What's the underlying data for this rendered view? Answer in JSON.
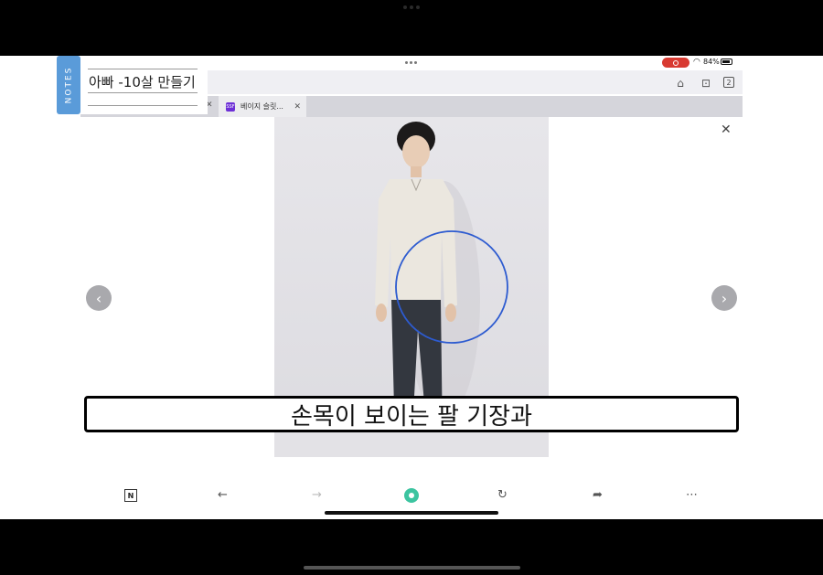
{
  "status": {
    "battery": "84%"
  },
  "notes": {
    "tab_label": "NOTES",
    "title": "아빠 -10살 만들기"
  },
  "browser": {
    "tab_count": "2"
  },
  "tabs": [
    {
      "label": "베이지 슬릿...",
      "favicon": "SSF",
      "active": true
    }
  ],
  "subtitle": "손목이 보이는 팔 기장과",
  "colors": {
    "accent_green": "#3cc4a0",
    "record_red": "#d83a31",
    "notes_blue": "#5a9bd9",
    "annotation_circle": "#2d5bd0"
  }
}
